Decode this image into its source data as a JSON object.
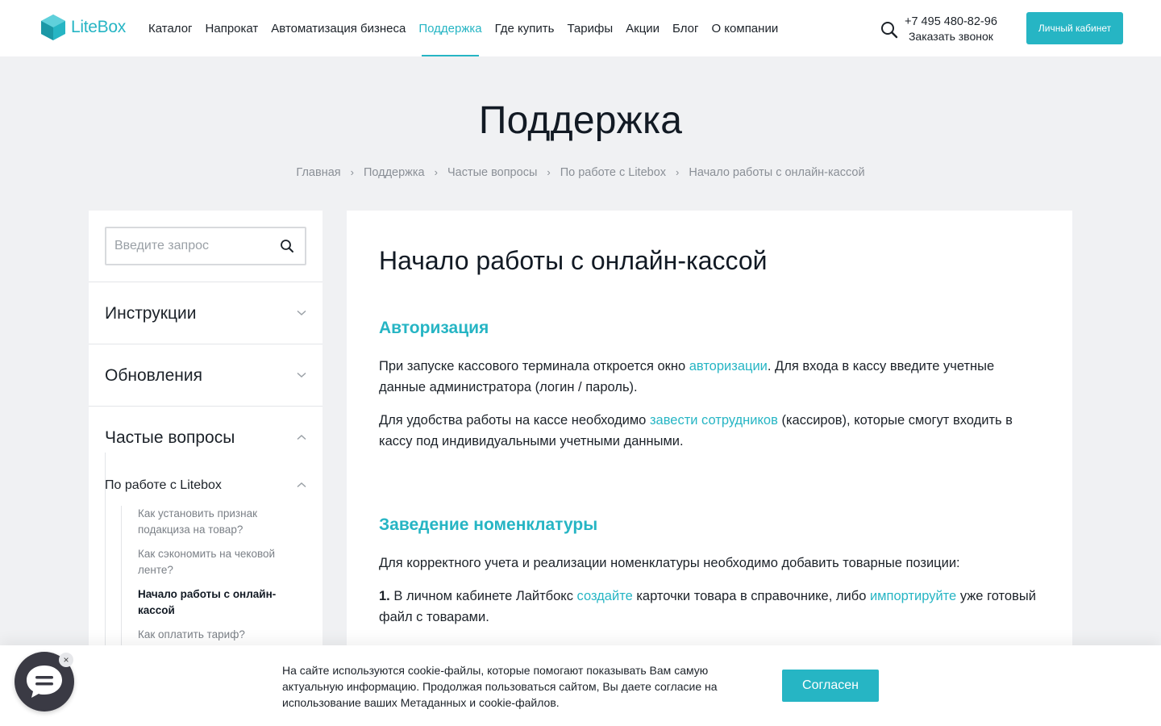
{
  "header": {
    "logo_text": "LiteBox",
    "nav": [
      {
        "label": "Каталог"
      },
      {
        "label": "Напрокат"
      },
      {
        "label": "Автоматизация бизнеса"
      },
      {
        "label": "Поддержка",
        "active": true
      },
      {
        "label": "Где купить"
      },
      {
        "label": "Тарифы"
      },
      {
        "label": "Акции"
      },
      {
        "label": "Блог"
      },
      {
        "label": "О компании"
      }
    ],
    "phone": "+7 495 480-82-96",
    "callback_label": "Заказать звонок",
    "cabinet_label": "Личный кабинет",
    "icons": {
      "search": "search-icon",
      "logo": "litebox-logo-icon"
    }
  },
  "page": {
    "title": "Поддержка",
    "breadcrumb": [
      "Главная",
      "Поддержка",
      "Частые вопросы",
      "По работе с Litebox",
      "Начало работы с онлайн-кассой"
    ]
  },
  "sidebar": {
    "search_placeholder": "Введите запрос",
    "sections": [
      {
        "label": "Инструкции",
        "expanded": false
      },
      {
        "label": "Обновления",
        "expanded": false
      },
      {
        "label": "Частые вопросы",
        "expanded": true
      }
    ],
    "subsection": {
      "label": "По работе с Litebox",
      "items": [
        "Как установить признак подакциза на товар?",
        "Как сэкономить на чековой ленте?",
        "Начало работы с онлайн-кассой",
        "Как оплатить тариф?"
      ],
      "current_index": 2
    }
  },
  "article": {
    "title": "Начало работы с онлайн-кассой",
    "section1": {
      "heading": "Авторизация",
      "p1_before": "При запуске кассового терминала откроется окно ",
      "p1_link": "авторизации",
      "p1_after": ". Для входа в кассу введите учетные данные администратора (логин / пароль).",
      "p2_before": "Для удобства работы на кассе необходимо ",
      "p2_link": "завести сотрудников",
      "p2_after": " (кассиров), которые смогут входить в кассу под индивидуальными учетными данными."
    },
    "section2": {
      "heading": "Заведение номенклатуры",
      "p1": "Для корректного учета и реализации номенклатуры необходимо добавить товарные позиции:",
      "p2_num": "1.",
      "p2_before": " В личном кабинете Лайтбокс ",
      "p2_link1": "создайте",
      "p2_mid": " карточки товара в справочнике, либо ",
      "p2_link2": "импортируйте",
      "p2_after": " уже готовый файл с товарами."
    }
  },
  "cookie": {
    "text": "На сайте используются cookie-файлы, которые помогают показывать Вам самую актуальную информацию. Продолжая пользоваться сайтом, Вы даете согласие на использование ваших Метаданных и cookie-файлов.",
    "agree_label": "Согласен"
  },
  "chat": {
    "icon": "chat-bubble-icon",
    "close_symbol": "×"
  },
  "colors": {
    "accent": "#26b5c4",
    "background": "#f0f1f3",
    "text": "#1c2229"
  }
}
